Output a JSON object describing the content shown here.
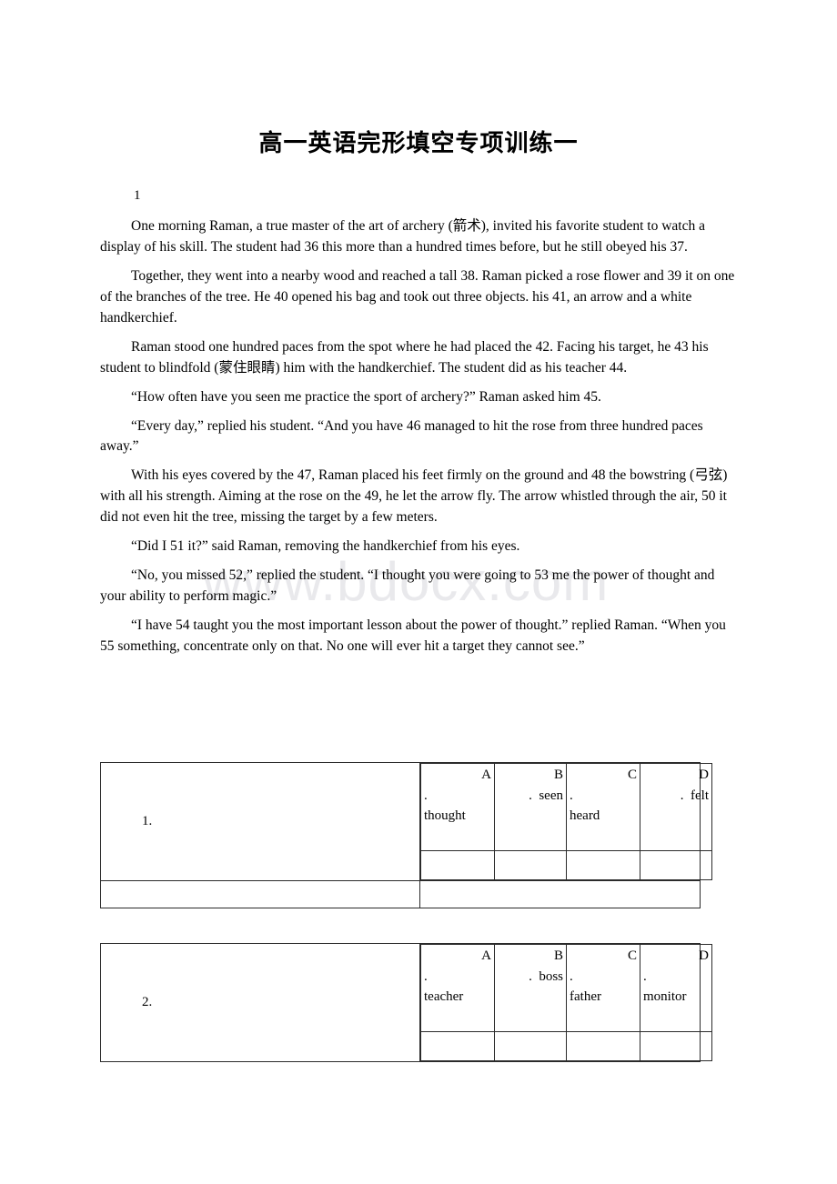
{
  "document": {
    "title": "高一英语完形填空专项训练一",
    "section_number": "1",
    "watermark": "www.bdocx.com"
  },
  "passage": {
    "paragraphs": [
      "One morning Raman, a true master of the art of archery (箭术), invited his favorite student to watch a display of his skill. The student had 36 this more than a hundred times before, but he still obeyed his 37.",
      "Together, they went into a nearby wood and reached a tall 38. Raman picked a rose flower and 39 it on one of the branches of the tree. He 40 opened his bag and took out three objects. his 41, an arrow and a white handkerchief.",
      "Raman stood one hundred paces from the spot where he had placed the 42. Facing his target, he 43 his student to blindfold (蒙住眼睛) him with the handkerchief. The student did as his teacher 44.",
      "“How often have you seen me practice the sport of archery?” Raman asked him 45.",
      "“Every day,” replied his student. “And you have 46 managed to hit the rose from three hundred paces away.”",
      "With his eyes covered by the 47, Raman placed his feet firmly on the ground and 48 the bowstring (弓弦) with all his strength. Aiming at the rose on the 49, he let the arrow fly. The arrow whistled through the air, 50 it did not even hit the tree, missing the target by a few meters.",
      "“Did I 51 it?” said Raman, removing the handkerchief from his eyes.",
      "“No, you missed 52,” replied the student. “I thought you were going to 53 me the power of thought and your ability to perform magic.”",
      "“I have 54 taught you the most important lesson about the power of thought.” replied Raman. “When you 55 something, concentrate only on that. No one will ever hit a target they cannot see.”"
    ]
  },
  "questions": [
    {
      "number": "1.",
      "options": [
        {
          "letter": "A",
          "dot": ".",
          "text": "thought"
        },
        {
          "letter": "B",
          "dot": ".",
          "text": "seen"
        },
        {
          "letter": "C",
          "dot": ".",
          "text": "heard"
        },
        {
          "letter": "D",
          "dot": ".",
          "text": "felt"
        }
      ]
    },
    {
      "number": "2.",
      "options": [
        {
          "letter": "A",
          "dot": ".",
          "text": "teacher"
        },
        {
          "letter": "B",
          "dot": ".",
          "text": "boss"
        },
        {
          "letter": "C",
          "dot": ".",
          "text": "father"
        },
        {
          "letter": "D",
          "dot": ".",
          "text": "monitor"
        }
      ]
    }
  ],
  "colors": {
    "text": "#000000",
    "border": "#2b2b2b",
    "watermark": "#e9e9ec",
    "background": "#ffffff"
  }
}
